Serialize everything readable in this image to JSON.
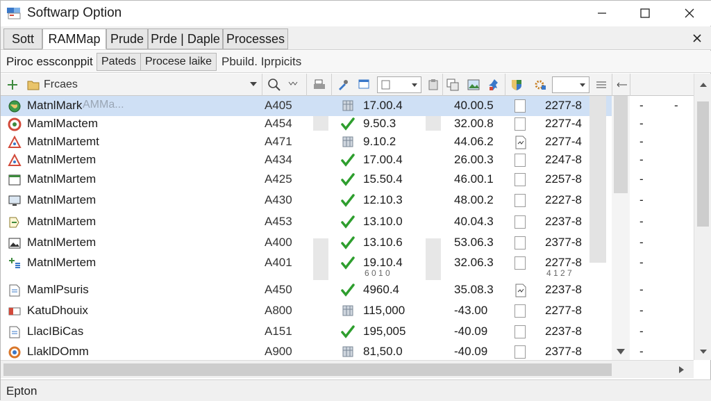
{
  "window": {
    "title": "Softwarp Option"
  },
  "tabs": [
    {
      "label": "Sott",
      "active": false
    },
    {
      "label": "RAMMap",
      "active": true
    },
    {
      "label": "Prude",
      "active": false
    },
    {
      "label": "Prde | Daple",
      "active": false
    },
    {
      "label": "Processes",
      "active": false
    }
  ],
  "subbar": {
    "label": "Piroc essconppit",
    "buttons": [
      "Pateds",
      "Procese laike"
    ],
    "text": "Pbuild. Iprpicits"
  },
  "toolbar": {
    "filter_label": "Frcaes"
  },
  "rows": [
    {
      "icon": "green-globe-icon",
      "name": "MatnlMark",
      "ghost": "AMMa...",
      "code": "A405",
      "status": "box-icon",
      "v1": "17.00.4",
      "v2": "40.00.5",
      "v3": "2277-8",
      "dash": "-",
      "dash2": "-",
      "check": "empty",
      "selected": true
    },
    {
      "icon": "red-ring-icon",
      "name": "MamlMactem",
      "code": "A454",
      "status": "check-icon",
      "v1": "9.50.3",
      "v2": "32.00.8",
      "v3": "2277-4",
      "dash": "-",
      "check": "empty"
    },
    {
      "icon": "warning-triangle-icon",
      "name": "MatnlMartemt",
      "code": "A471",
      "status": "box-icon",
      "v1": "9.10.2",
      "v2": "44.06.2",
      "v3": "2277-4",
      "dash": "-",
      "check": "doc"
    },
    {
      "icon": "warning-triangle-icon",
      "name": "MatnlMertem",
      "code": "A434",
      "status": "check-icon",
      "v1": "17.00.4",
      "v2": "26.00.3",
      "v3": "2247-8",
      "dash": "-",
      "check": "empty"
    },
    {
      "icon": "window-icon",
      "name": "MatnlMartem",
      "code": "A425",
      "status": "check-icon",
      "v1": "15.50.4",
      "v2": "46.00.1",
      "v3": "2257-8",
      "dash": "-",
      "check": "empty"
    },
    {
      "icon": "monitor-icon",
      "name": "MatnlMartem",
      "code": "A430",
      "status": "check-icon",
      "v1": "12.10.3",
      "v2": "48.00.2",
      "v3": "2227-8",
      "dash": "-",
      "check": "empty"
    },
    {
      "icon": "arrow-doc-icon",
      "name": "MatnlMartem",
      "code": "A453",
      "status": "check-icon",
      "v1": "13.10.0",
      "v2": "40.04.3",
      "v3": "2237-8",
      "dash": "-",
      "check": "empty"
    },
    {
      "icon": "image-icon",
      "name": "MatnlMertem",
      "code": "A400",
      "status": "check-icon",
      "v1": "13.10.6",
      "v2": "53.06.3",
      "v3": "2377-8",
      "dash": "-",
      "check": "empty"
    },
    {
      "icon": "sparkle-icon",
      "name": "MatnlMertem",
      "code": "A401",
      "status": "check-icon",
      "v1": "19.10.4",
      "v2": "32.06.3",
      "v3": "2277-8",
      "dash": "-",
      "check": "empty",
      "sub": [
        "6 0 1 0",
        "4 1 2 7"
      ]
    },
    {
      "icon": "document-icon",
      "name": "MamlPsuris",
      "code": "A450",
      "status": "check-icon",
      "v1": "4960.4",
      "v2": "35.08.3",
      "v3": "2237-8",
      "dash": "-",
      "check": "doc"
    },
    {
      "icon": "red-card-icon",
      "name": "KatuDhouix",
      "code": "A800",
      "status": "box-icon",
      "v1": "115,000",
      "v2": "-43.00",
      "v3": "2277-8",
      "dash": "-",
      "check": "empty"
    },
    {
      "icon": "document-icon",
      "name": "LlacIBiCas",
      "code": "A151",
      "status": "check-icon",
      "v1": "195,005",
      "v2": "-40.09",
      "v3": "2237-8",
      "dash": "-",
      "check": "empty"
    },
    {
      "icon": "gear-orange-icon",
      "name": "LlaklDOmm",
      "code": "A900",
      "status": "box-icon",
      "v1": "81,50.0",
      "v2": "-40.09",
      "v3": "2377-8",
      "dash": "-",
      "check": "empty"
    }
  ],
  "status_bar": {
    "text": "Epton"
  },
  "colors": {
    "selection": "#cfe0f5",
    "check_green": "#2e9e2e",
    "warning_red": "#d9472b"
  }
}
